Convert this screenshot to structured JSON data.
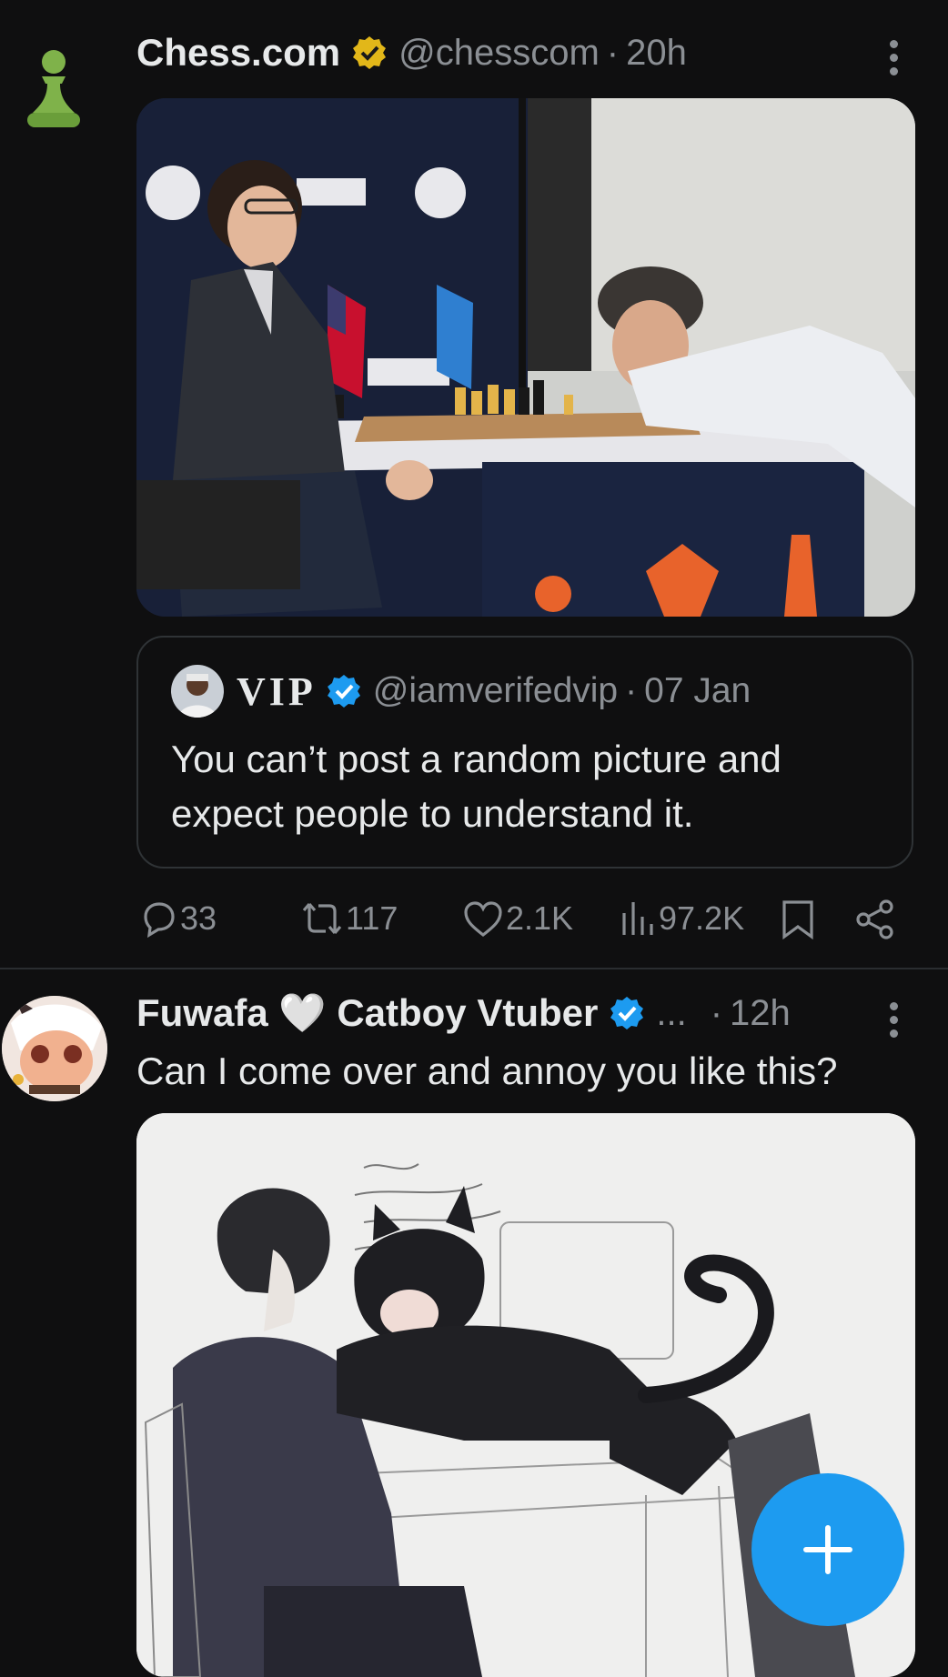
{
  "tweet1": {
    "name": "Chess.com",
    "handle": "@chesscom",
    "separator": "·",
    "time": "20h",
    "avatar_icon": "pawn-icon",
    "verified_badge_color": "#e2b719",
    "media_icon": "chess-match-photo",
    "quote": {
      "name": "VIP",
      "handle": "@iamverifedvip",
      "separator": "·",
      "date": "07 Jan",
      "text_line1": "You can’t post a random picture and",
      "text_line2": "expect people to understand it."
    },
    "actions": {
      "replies": "33",
      "reposts": "117",
      "likes": "2.1K",
      "views": "97.2K"
    }
  },
  "tweet2": {
    "name": "Fuwafa 🤍 Catboy Vtuber",
    "ellipsis": "...",
    "separator": "·",
    "time": "12h",
    "text": "Can I come over and annoy you like this?",
    "verified_badge_color": "#1d9bf0",
    "media_icon": "catboy-sketch-drawing"
  },
  "fab": {
    "icon": "plus-icon",
    "color": "#1d9bf0"
  }
}
